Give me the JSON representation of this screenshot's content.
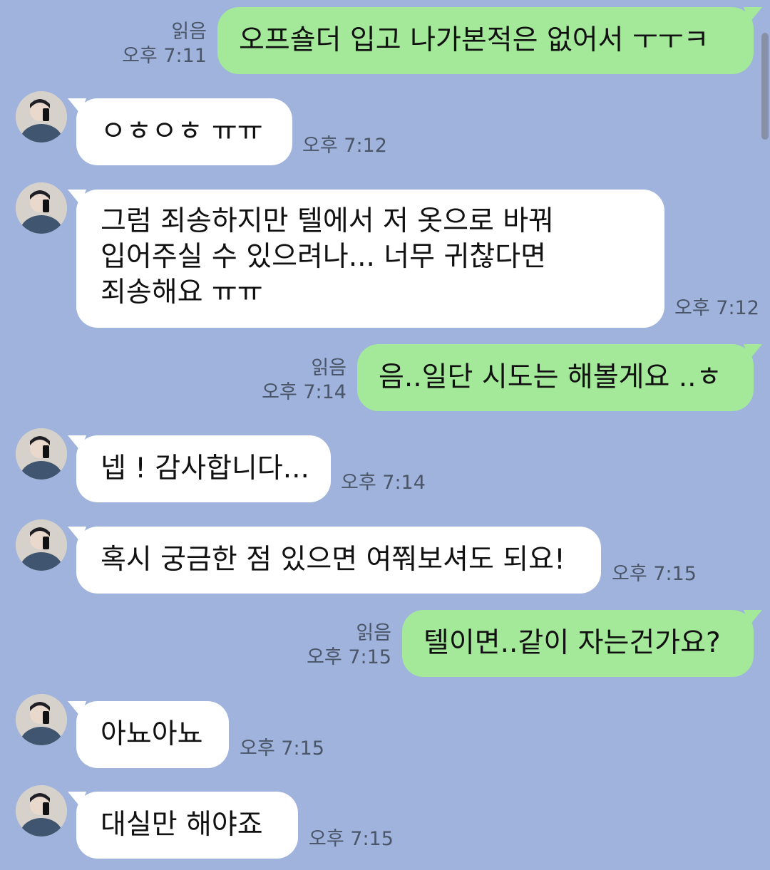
{
  "chat": {
    "messages": [
      {
        "side": "out",
        "lines": [
          "오프숄더 입고 나가본적은 없어서 ㅜㅜㅋ"
        ],
        "read": "읽음",
        "time": "오후 7:11"
      },
      {
        "side": "in",
        "lines": [
          "ㅇㅎㅇㅎ ㅠㅠ"
        ],
        "time": "오후 7:12"
      },
      {
        "side": "in",
        "lines": [
          "그럼 죄송하지만 텔에서 저 옷으로 바꿔",
          "입어주실 수 있으려나... 너무 귀찮다면",
          "죄송해요 ㅠㅠ"
        ],
        "time": "오후 7:12"
      },
      {
        "side": "out",
        "lines": [
          "음..일단 시도는 해볼게요 ..ㅎ"
        ],
        "read": "읽음",
        "time": "오후 7:14"
      },
      {
        "side": "in",
        "lines": [
          "넵 ! 감사합니다..."
        ],
        "time": "오후 7:14"
      },
      {
        "side": "in",
        "lines": [
          "혹시 궁금한 점 있으면 여쭤보셔도 되요!"
        ],
        "time": "오후 7:15"
      },
      {
        "side": "out",
        "lines": [
          "텔이면..같이 자는건가요?"
        ],
        "read": "읽음",
        "time": "오후 7:15"
      },
      {
        "side": "in",
        "lines": [
          "아뇨아뇨"
        ],
        "time": "오후 7:15"
      },
      {
        "side": "in",
        "lines": [
          "대실만 해야죠"
        ],
        "time": "오후 7:15"
      }
    ]
  },
  "colors": {
    "background": "#9fb3dc",
    "bubble_out": "#a4e89a",
    "bubble_in": "#ffffff",
    "meta_text": "#4a5568"
  },
  "icons": {
    "avatar": "profile-photo-icon"
  }
}
